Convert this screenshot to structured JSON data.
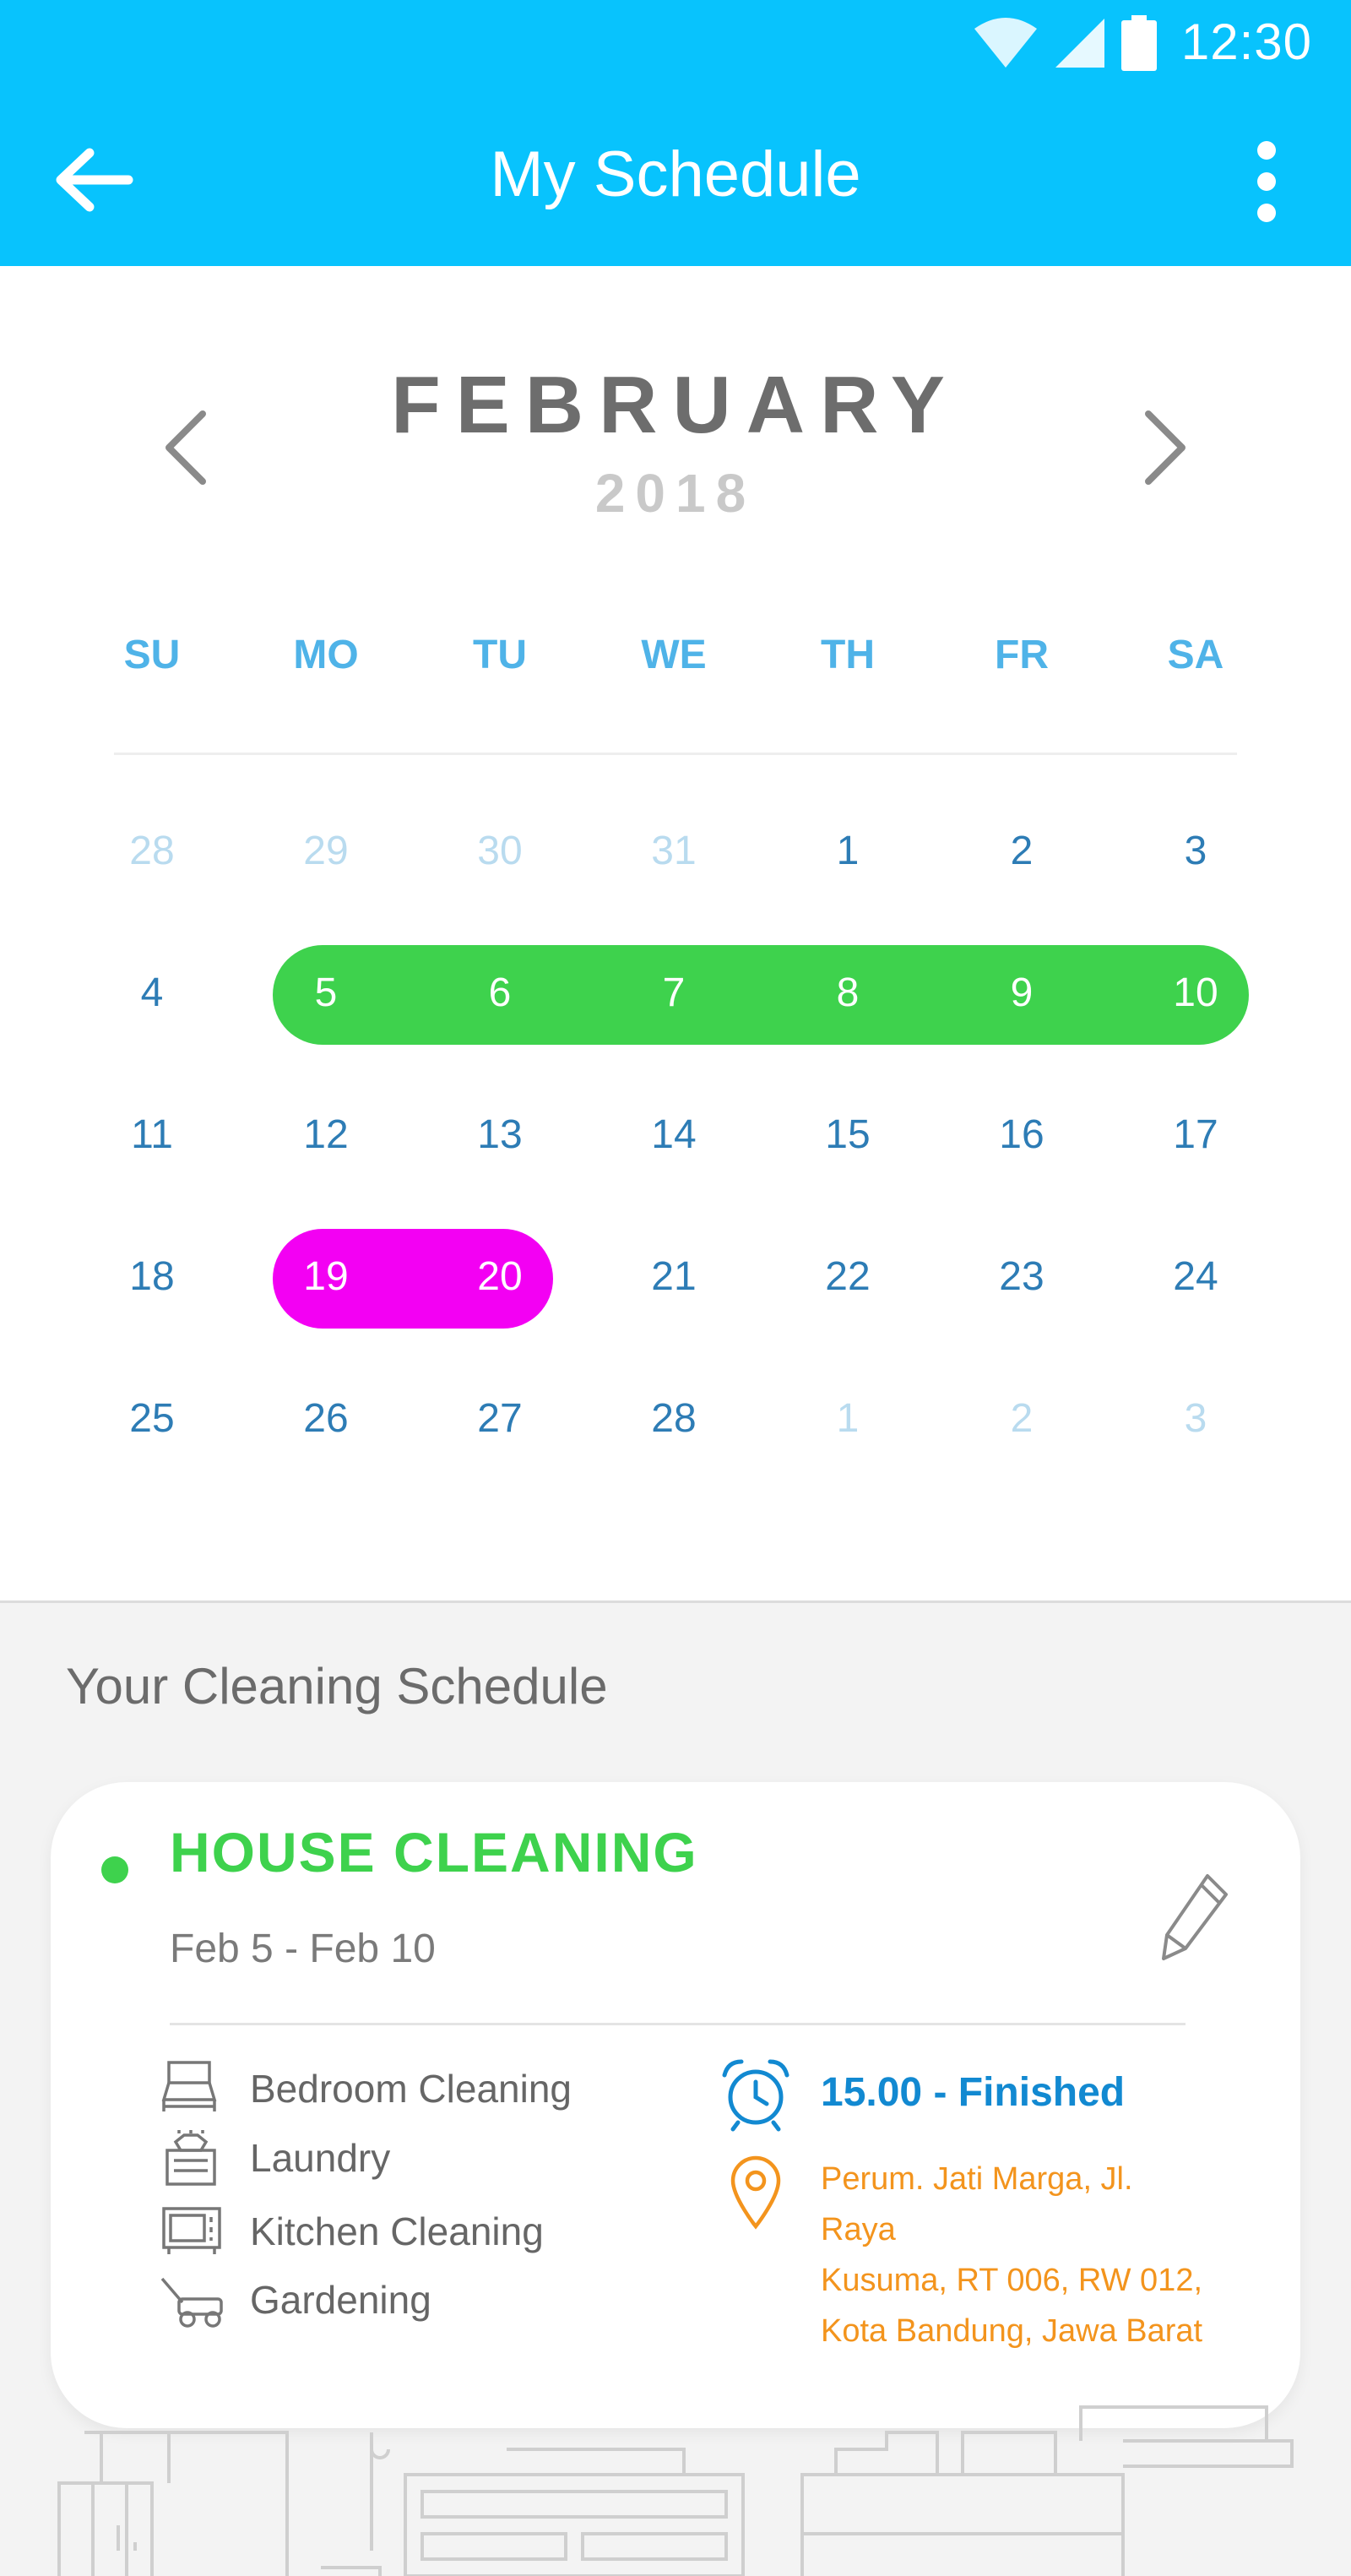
{
  "status_bar": {
    "time": "12:30",
    "bg_color": "#08c3fd"
  },
  "app_bar": {
    "title": "My Schedule",
    "back_icon": "arrow-left-icon",
    "menu_icon": "more-vert-icon"
  },
  "calendar": {
    "month": "FEBRUARY",
    "year": "2018",
    "weekdays": [
      "SU",
      "MO",
      "TU",
      "WE",
      "TH",
      "FR",
      "SA"
    ],
    "weeks": [
      [
        "28",
        "29",
        "30",
        "31",
        "1",
        "2",
        "3"
      ],
      [
        "4",
        "5",
        "6",
        "7",
        "8",
        "9",
        "10"
      ],
      [
        "11",
        "12",
        "13",
        "14",
        "15",
        "16",
        "17"
      ],
      [
        "18",
        "19",
        "20",
        "21",
        "22",
        "23",
        "24"
      ],
      [
        "25",
        "26",
        "27",
        "28",
        "1",
        "2",
        "3"
      ]
    ],
    "outside_month": [
      [
        0,
        0
      ],
      [
        0,
        1
      ],
      [
        0,
        2
      ],
      [
        0,
        3
      ],
      [
        4,
        4
      ],
      [
        4,
        5
      ],
      [
        4,
        6
      ]
    ],
    "ranges": [
      {
        "week": 1,
        "start": 1,
        "end": 6,
        "color": "#3ed24d"
      },
      {
        "week": 3,
        "start": 1,
        "end": 2,
        "color": "#f300f3"
      }
    ]
  },
  "schedule": {
    "section_title": "Your Cleaning Schedule",
    "card": {
      "title": "HOUSE CLEANING",
      "status_color": "#3ed24d",
      "dates": "Feb 5 - Feb 10",
      "edit_icon": "pencil-icon",
      "tasks": [
        {
          "icon": "bed-icon",
          "label": "Bedroom Cleaning"
        },
        {
          "icon": "laundry-icon",
          "label": "Laundry"
        },
        {
          "icon": "microwave-icon",
          "label": "Kitchen Cleaning"
        },
        {
          "icon": "lawn-mower-icon",
          "label": "Gardening"
        }
      ],
      "time_status": "15.00 - Finished",
      "address_lines": [
        "Perum. Jati Marga, Jl. Raya",
        "Kusuma, RT 006, RW 012,",
        "Kota Bandung, Jawa Barat"
      ]
    }
  }
}
